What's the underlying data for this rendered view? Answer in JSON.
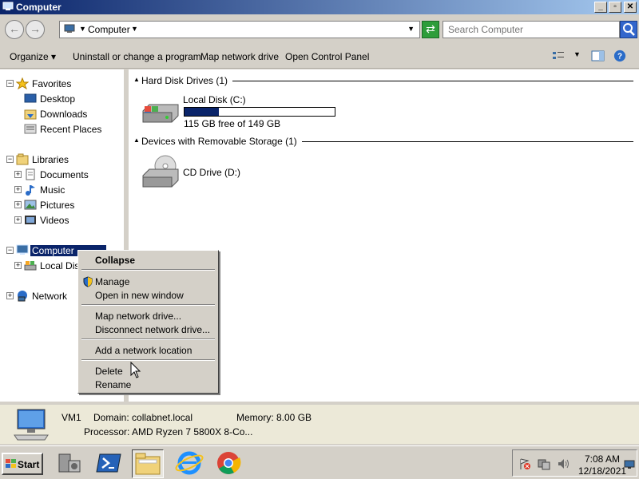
{
  "window": {
    "title": "Computer",
    "icon": "computer-icon"
  },
  "titlebar_buttons": {
    "minimize": "_",
    "maximize": "▫",
    "close": "✕"
  },
  "address": {
    "back": "←",
    "forward": "→",
    "breadcrumb": "Computer",
    "search_placeholder": "Search Computer"
  },
  "commands": {
    "organize": "Organize",
    "uninstall": "Uninstall or change a program",
    "map_drive": "Map network drive",
    "control_panel": "Open Control Panel"
  },
  "nav": {
    "favorites": {
      "label": "Favorites",
      "items": [
        "Desktop",
        "Downloads",
        "Recent Places"
      ]
    },
    "libraries": {
      "label": "Libraries",
      "items": [
        "Documents",
        "Music",
        "Pictures",
        "Videos"
      ]
    },
    "computer": {
      "label": "Computer",
      "items": [
        "Local Disk"
      ]
    },
    "network": {
      "label": "Network"
    }
  },
  "content": {
    "groups": [
      {
        "title": "Hard Disk Drives (1)"
      },
      {
        "title": "Devices with Removable Storage (1)"
      }
    ],
    "drives": [
      {
        "name": "Local Disk (C:)",
        "free_text": "115 GB free of 149 GB",
        "used_fraction": 0.228
      },
      {
        "name": "CD Drive (D:)"
      }
    ]
  },
  "details": {
    "name": "VM1",
    "domain": "Domain: collabnet.local",
    "memory": "Memory: 8.00 GB",
    "processor": "Processor: AMD Ryzen 7 5800X 8-Co..."
  },
  "context_menu": {
    "collapse": "Collapse",
    "manage": "Manage",
    "open_new_window": "Open in new window",
    "map_network_drive": "Map network drive...",
    "disconnect_network_drive": "Disconnect network drive...",
    "add_network_location": "Add a network location",
    "delete": "Delete",
    "rename": "Rename"
  },
  "taskbar": {
    "start": "Start",
    "time": "7:08 AM",
    "date": "12/18/2021"
  },
  "colors": {
    "selection": "#0a246a",
    "titlebar": "#0a246a"
  }
}
